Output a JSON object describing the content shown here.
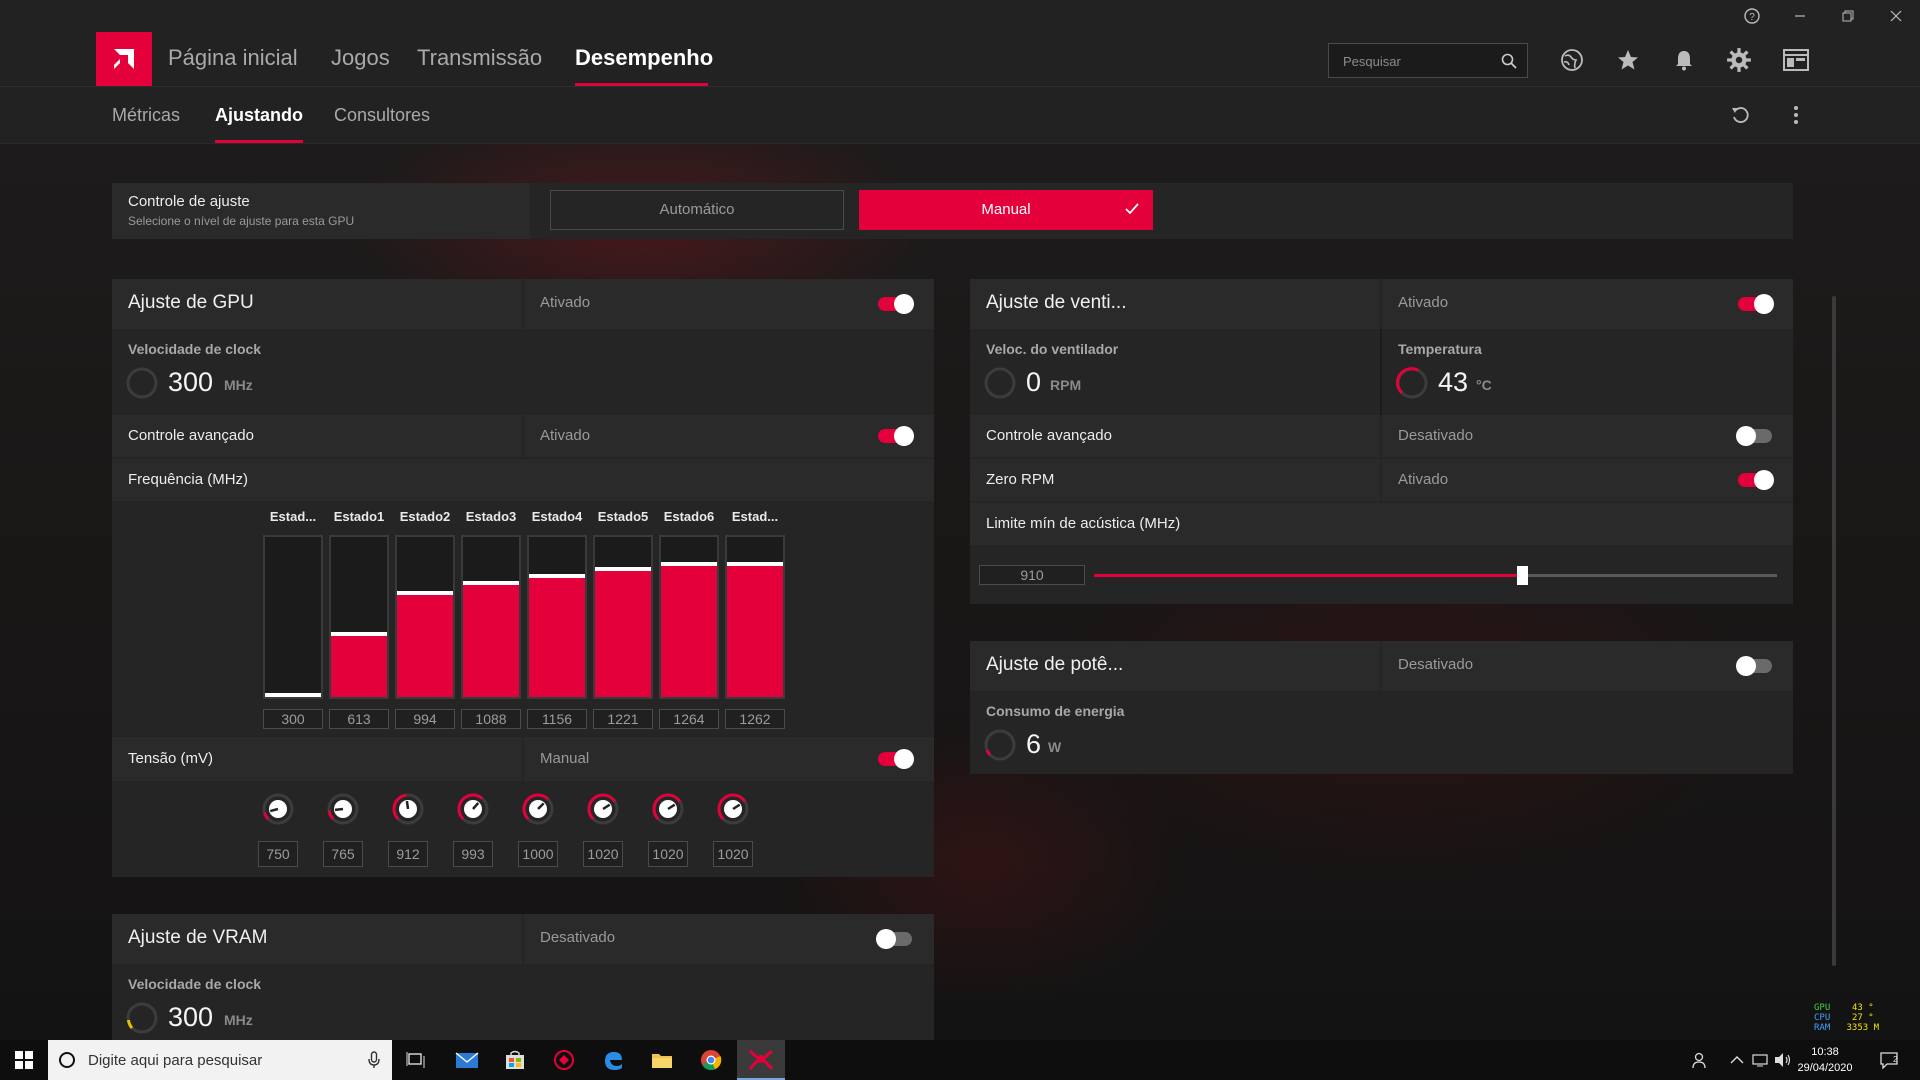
{
  "nav": {
    "tabs": [
      "Página inicial",
      "Jogos",
      "Transmissão",
      "Desempenho"
    ],
    "search_placeholder": "Pesquisar"
  },
  "subnav": {
    "tabs": [
      "Métricas",
      "Ajustando",
      "Consultores"
    ]
  },
  "control": {
    "title": "Controle de ajuste",
    "subtitle": "Selecione o nível de ajuste para esta GPU",
    "auto_label": "Automático",
    "manual_label": "Manual"
  },
  "gpu": {
    "title": "Ajuste de GPU",
    "status": "Ativado",
    "clock_label": "Velocidade de clock",
    "clock_value": "300",
    "clock_unit": "MHz",
    "adv_label": "Controle avançado",
    "adv_status": "Ativado",
    "freq_label": "Frequência (MHz)",
    "states": [
      "Estad...",
      "Estado1",
      "Estado2",
      "Estado3",
      "Estado4",
      "Estado5",
      "Estado6",
      "Estad..."
    ],
    "freq_values": [
      "300",
      "613",
      "994",
      "1088",
      "1156",
      "1221",
      "1264",
      "1262"
    ],
    "volt_label": "Tensão (mV)",
    "volt_status": "Manual",
    "volt_values": [
      "750",
      "765",
      "912",
      "993",
      "1000",
      "1020",
      "1020",
      "1020"
    ]
  },
  "vram": {
    "title": "Ajuste de VRAM",
    "status": "Desativado",
    "clock_label": "Velocidade de clock",
    "clock_value": "300",
    "clock_unit": "MHz"
  },
  "fan": {
    "title": "Ajuste de venti...",
    "status": "Ativado",
    "speed_label": "Veloc. do ventilador",
    "speed_value": "0",
    "speed_unit": "RPM",
    "temp_label": "Temperatura",
    "temp_value": "43",
    "temp_unit": "°C",
    "adv_label": "Controle avançado",
    "adv_status": "Desativado",
    "zero_label": "Zero RPM",
    "zero_status": "Ativado",
    "acoustic_label": "Limite mín de acústica (MHz)",
    "acoustic_value": "910"
  },
  "power": {
    "title": "Ajuste de potê...",
    "status": "Desativado",
    "consumption_label": "Consumo de energia",
    "consumption_value": "6",
    "consumption_unit": "W"
  },
  "taskbar": {
    "search_placeholder": "Digite aqui para pesquisar",
    "time": "10:38",
    "date": "29/04/2020",
    "osd_gpu": "43 °",
    "osd_cpu": "27 °",
    "osd_ram": "3353 M"
  },
  "colors": {
    "accent": "#e4003a",
    "panel": "#252525",
    "header": "#2a2a2a"
  }
}
